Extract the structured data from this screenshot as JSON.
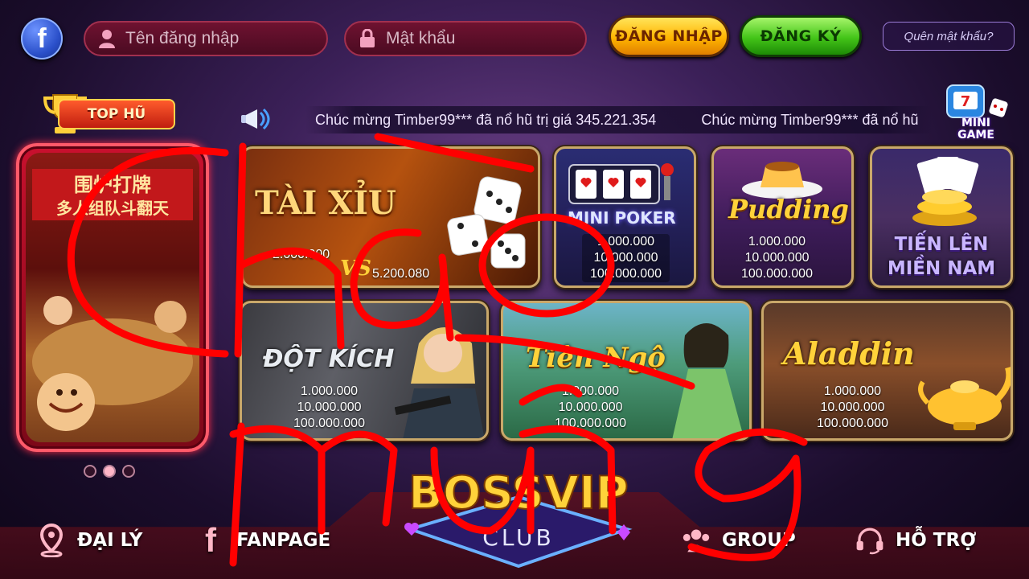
{
  "header": {
    "facebook_icon": "facebook-icon",
    "username_placeholder": "Tên đăng nhập",
    "password_placeholder": "Mật khẩu",
    "login_label": "ĐĂNG NHẬP",
    "register_label": "ĐĂNG KÝ",
    "forgot_label": "Quên mật khẩu?"
  },
  "ticker": {
    "messages": [
      "Chúc mừng Timber99*** đã nổ hũ  trị giá 345.221.354",
      "Chúc mừng Timber99*** đã nổ hũ"
    ]
  },
  "top_jackpot": {
    "title": "TOP HŨ",
    "pages": 3,
    "active_page": 2
  },
  "mini_game": {
    "label_line1": "MINI",
    "label_line2": "GAME"
  },
  "games": {
    "taixiu": {
      "title": "TÀI XỈU",
      "left_value": "2.000.000",
      "vs": "VS",
      "right_value": "5.200.080"
    },
    "minipoker": {
      "title": "MINI POKER",
      "values": [
        "1.000.000",
        "10.000.000",
        "100.000.000"
      ]
    },
    "pudding": {
      "title": "Pudding",
      "values": [
        "1.000.000",
        "10.000.000",
        "100.000.000"
      ]
    },
    "tienlen": {
      "title_line1": "TIẾN LÊN",
      "title_line2": "MIỀN NAM"
    },
    "dotkich": {
      "title": "ĐỘT KÍCH",
      "values": [
        "1.000.000",
        "10.000.000",
        "100.000.000"
      ]
    },
    "tienngoi": {
      "title": "Tiên Ngộ",
      "values": [
        "1.000.000",
        "10.000.000",
        "100.000.000"
      ]
    },
    "aladdin": {
      "title": "Aladdin",
      "values": [
        "1.000.000",
        "10.000.000",
        "100.000.000"
      ]
    }
  },
  "logo": {
    "line1": "BOSSVIP",
    "line2": "CLUB"
  },
  "bottom_nav": {
    "agent": "ĐẠI LÝ",
    "fanpage": "FANPAGE",
    "group": "GROUP",
    "support": "HỖ TRỢ"
  },
  "overlay_text": {
    "line1": "Chào",
    "line2": "Mừng"
  },
  "colors": {
    "login": "#ffb400",
    "register": "#43c418",
    "overlay": "#ff0000",
    "field_bg": "#6e1230"
  }
}
